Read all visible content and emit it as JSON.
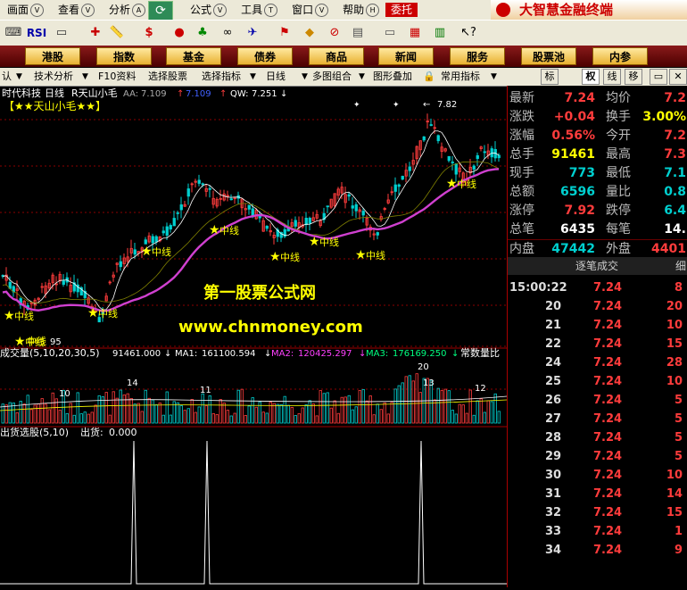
{
  "menubar": {
    "items": [
      {
        "label": "画面",
        "arrow": "V"
      },
      {
        "label": "查看",
        "arrow": "V"
      },
      {
        "label": "分析",
        "arrow": "A"
      },
      {
        "label": "公式",
        "arrow": "V"
      },
      {
        "label": "工具",
        "arrow": "T"
      },
      {
        "label": "窗口",
        "arrow": "V"
      },
      {
        "label": "帮助",
        "arrow": "H"
      }
    ],
    "entrust": "委托",
    "brand": "大智慧金融终端"
  },
  "toolbar": {
    "rsi": "RSI"
  },
  "nav": {
    "buttons": [
      "港股",
      "指数",
      "基金",
      "债券",
      "商品",
      "新闻",
      "服务",
      "股票池",
      "内参"
    ]
  },
  "ctrlbar": {
    "items": [
      "认",
      "技术分析",
      "F10资料",
      "选择股票",
      "选择指标",
      "日线",
      "多图组合",
      "图形叠加",
      "常用指标"
    ],
    "tabs": [
      "标",
      "权",
      "线",
      "移"
    ],
    "active_tab": "权"
  },
  "chart": {
    "stock_name": "时代科技",
    "period": "日线",
    "indicator_name": "R天山小毛",
    "aa_label": "AA:",
    "aa_value": "7.109",
    "second_value": "7.109",
    "qw_label": "QW:",
    "qw_value": "7.251",
    "legend_title": "【★★天山小毛★★】",
    "high_marker": "7.82",
    "signal_label": "中线",
    "bottom_label": "95",
    "watermark_cn": "第一股票公式网",
    "watermark_url": "www.chnmoney.com",
    "volume_header": "成交量(5,10,20,30,5)",
    "vol_value": "91461.000",
    "ma1_label": "MA1:",
    "ma1_value": "161100.594",
    "ma2_label": "MA2:",
    "ma2_value": "120425.297",
    "ma3_label": "MA3:",
    "ma3_value": "176169.250",
    "vol_right_label": "常数量比",
    "vol_markers": [
      "14",
      "10",
      "11",
      "20",
      "13",
      "12"
    ],
    "sell_header": "出货选股(5,10)",
    "sell_label": "出货:",
    "sell_value": "0.000"
  },
  "colors": {
    "ma_purple": "#d040d0",
    "up": "#ff3c3c",
    "down": "#00d0d0",
    "signal": "#ffff00",
    "grid": "#8b0000"
  },
  "quote": {
    "rows": [
      {
        "l1": "最新",
        "v1": "7.24",
        "c1": "#ff3c3c",
        "l2": "均价",
        "v2": "7.2",
        "c2": "#ff3c3c"
      },
      {
        "l1": "涨跌",
        "v1": "+0.04",
        "c1": "#ff3c3c",
        "l2": "换手",
        "v2": "3.00%",
        "c2": "#ffff00"
      },
      {
        "l1": "涨幅",
        "v1": "0.56%",
        "c1": "#ff3c3c",
        "l2": "今开",
        "v2": "7.2",
        "c2": "#ff3c3c"
      },
      {
        "l1": "总手",
        "v1": "91461",
        "c1": "#ffff00",
        "l2": "最高",
        "v2": "7.3",
        "c2": "#ff3c3c"
      },
      {
        "l1": "现手",
        "v1": "773",
        "c1": "#00d0d0",
        "l2": "最低",
        "v2": "7.1",
        "c2": "#00d0d0"
      },
      {
        "l1": "总额",
        "v1": "6596",
        "c1": "#00d0d0",
        "l2": "量比",
        "v2": "0.8",
        "c2": "#00d0d0"
      },
      {
        "l1": "涨停",
        "v1": "7.92",
        "c1": "#ff3c3c",
        "l2": "跌停",
        "v2": "6.4",
        "c2": "#00d0d0"
      },
      {
        "l1": "总笔",
        "v1": "6435",
        "c1": "#ffffff",
        "l2": "每笔",
        "v2": "14.",
        "c2": "#ffffff"
      },
      {
        "l1": "内盘",
        "v1": "47442",
        "c1": "#00d0d0",
        "l2": "外盘",
        "v2": "4401",
        "c2": "#ff3c3c"
      }
    ],
    "tick_header": "逐笔成交",
    "tick_header_right": "细",
    "ticks": [
      {
        "t": "15:00:22",
        "p": "7.24",
        "v": "8"
      },
      {
        "t": "20",
        "p": "7.24",
        "v": "20"
      },
      {
        "t": "21",
        "p": "7.24",
        "v": "10"
      },
      {
        "t": "22",
        "p": "7.24",
        "v": "15"
      },
      {
        "t": "24",
        "p": "7.24",
        "v": "28"
      },
      {
        "t": "25",
        "p": "7.24",
        "v": "10"
      },
      {
        "t": "26",
        "p": "7.24",
        "v": "5"
      },
      {
        "t": "27",
        "p": "7.24",
        "v": "5"
      },
      {
        "t": "28",
        "p": "7.24",
        "v": "5"
      },
      {
        "t": "29",
        "p": "7.24",
        "v": "5"
      },
      {
        "t": "30",
        "p": "7.24",
        "v": "10"
      },
      {
        "t": "31",
        "p": "7.24",
        "v": "14"
      },
      {
        "t": "32",
        "p": "7.24",
        "v": "15"
      },
      {
        "t": "33",
        "p": "7.24",
        "v": "1"
      },
      {
        "t": "34",
        "p": "7.24",
        "v": "9"
      }
    ]
  }
}
